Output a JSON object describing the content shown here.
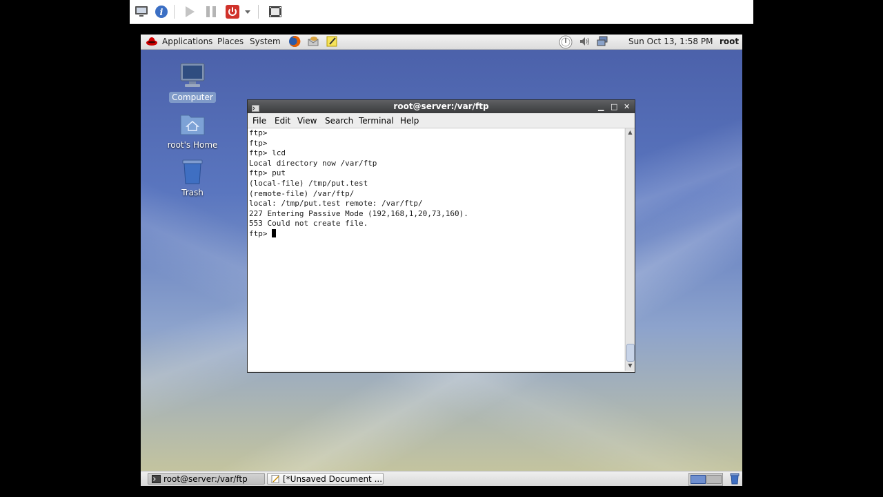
{
  "vm_toolbar": {
    "icons": [
      "monitor-icon",
      "info-icon",
      "play-icon",
      "pause-icon",
      "power-icon",
      "dropdown-arrow-icon",
      "film-icon"
    ]
  },
  "top_panel": {
    "applications": "Applications",
    "places": "Places",
    "system": "System",
    "clock": "Sun Oct 13,  1:58 PM",
    "user": "root"
  },
  "desktop_icons": [
    {
      "label": "Computer"
    },
    {
      "label": "root's Home"
    },
    {
      "label": "Trash"
    }
  ],
  "terminal": {
    "title": "root@server:/var/ftp",
    "menu": [
      "File",
      "Edit",
      "View",
      "Search",
      "Terminal",
      "Help"
    ],
    "lines": [
      "ftp>",
      "ftp>",
      "ftp> lcd",
      "Local directory now /var/ftp",
      "ftp> put",
      "(local-file) /tmp/put.test",
      "(remote-file) /var/ftp/",
      "local: /tmp/put.test remote: /var/ftp/",
      "227 Entering Passive Mode (192,168,1,20,73,160).",
      "553 Could not create file.",
      "ftp> "
    ]
  },
  "taskbar": {
    "items": [
      {
        "label": "root@server:/var/ftp"
      },
      {
        "label": "[*Unsaved Document ..."
      }
    ]
  }
}
